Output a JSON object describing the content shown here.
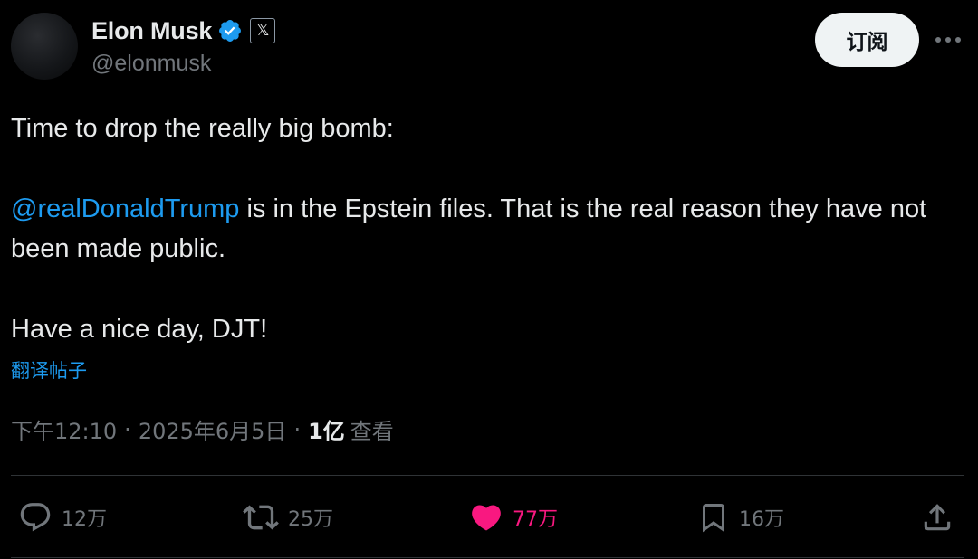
{
  "author": {
    "display_name": "Elon Musk",
    "handle": "@elonmusk",
    "verified_color": "#1d9bf0",
    "affiliate_badge": "𝕏"
  },
  "header": {
    "subscribe_label": "订阅",
    "more_icon": "more-horizontal-icon"
  },
  "tweet": {
    "line1": "Time to drop the really big bomb:",
    "mention": "@realDonaldTrump",
    "line2_rest": " is in the Epstein files. That is the real reason they have not been made public.",
    "line3": "Have a nice day, DJT!",
    "translate_label": "翻译帖子"
  },
  "meta": {
    "time": "下午12:10",
    "separator": "·",
    "date": "2025年6月5日",
    "views_count": "1亿",
    "views_label": "查看"
  },
  "actions": {
    "reply": {
      "icon": "reply-icon",
      "count": "12万"
    },
    "repost": {
      "icon": "repost-icon",
      "count": "25万"
    },
    "like": {
      "icon": "heart-icon",
      "count": "77万",
      "color": "#f91880",
      "liked": true
    },
    "bookmark": {
      "icon": "bookmark-icon",
      "count": "16万"
    },
    "share": {
      "icon": "share-icon"
    }
  },
  "colors": {
    "background": "#000000",
    "text": "#e7e9ea",
    "secondary": "#71767b",
    "accent": "#1d9bf0",
    "like": "#f91880"
  }
}
